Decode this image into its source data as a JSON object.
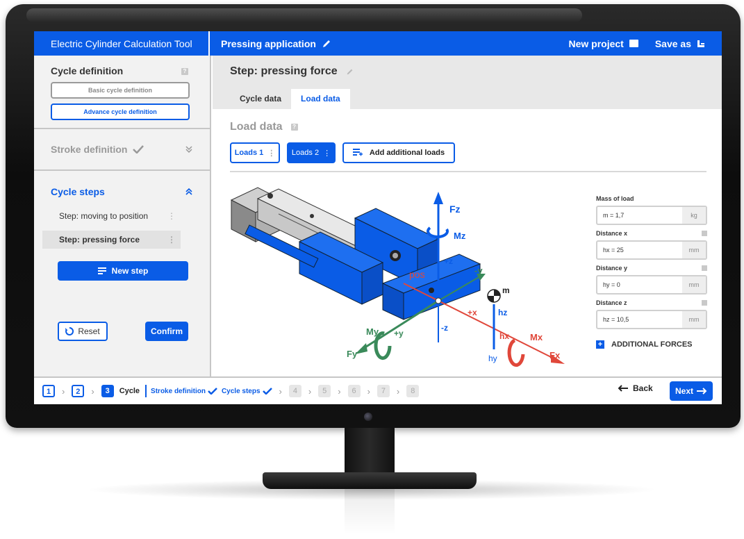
{
  "topbar": {
    "app_title": "Electric Cylinder Calculation Tool",
    "project_title": "Pressing application",
    "new_project_label": "New project",
    "save_as_label": "Save as"
  },
  "sidebar": {
    "cycle_definition": {
      "title": "Cycle definition",
      "help": "?",
      "basic_label": "Basic cycle definition",
      "advance_label": "Advance cycle definition"
    },
    "stroke_definition": {
      "title": "Stroke definition"
    },
    "cycle_steps": {
      "title": "Cycle steps",
      "items": [
        {
          "label": "Step: moving to position"
        },
        {
          "label": "Step: pressing force"
        }
      ],
      "new_step_label": "New step"
    },
    "reset_label": "Reset",
    "confirm_label": "Confirm"
  },
  "main": {
    "step_title": "Step: pressing force",
    "tabs": [
      {
        "label": "Cycle data"
      },
      {
        "label": "Load data"
      }
    ],
    "load_title": "Load data",
    "loads": [
      {
        "label": "Loads 1"
      },
      {
        "label": "Loads 2"
      }
    ],
    "add_loads_label": "Add additional loads",
    "diagram": {
      "labels": {
        "fz": "Fz",
        "mz": "Mz",
        "plus_z": "+z",
        "minus_z": "-z",
        "minus_y": "-y",
        "plus_y": "+y",
        "plus_x": "+x",
        "minus_x": "-x",
        "pos": "pos",
        "m": "m",
        "hz": "hz",
        "hx": "hx",
        "hy": "hy",
        "my": "My",
        "fy": "Fy",
        "mx": "Mx",
        "fx": "Fx"
      }
    },
    "params": {
      "mass_label": "Mass of load",
      "mass_value": "m = 1,7",
      "mass_unit": "kg",
      "dx_label": "Distance x",
      "dx_value": "hx = 25",
      "dx_unit": "mm",
      "dy_label": "Distance y",
      "dy_value": "hy = 0",
      "dy_unit": "mm",
      "dz_label": "Distance z",
      "dz_value": "hz = 10,5",
      "dz_unit": "mm",
      "additional_forces": "ADDITIONAL FORCES"
    }
  },
  "bottom_nav": {
    "steps": [
      "1",
      "2",
      "3",
      "4",
      "5",
      "6",
      "7",
      "8"
    ],
    "cycle_label": "Cycle",
    "stroke_def_label": "Stroke definition",
    "cycle_steps_label": "Cycle steps",
    "back_label": "Back",
    "next_label": "Next"
  },
  "colors": {
    "accent": "#0a5ce6",
    "red": "#e0473a",
    "green": "#3a8a5a"
  }
}
